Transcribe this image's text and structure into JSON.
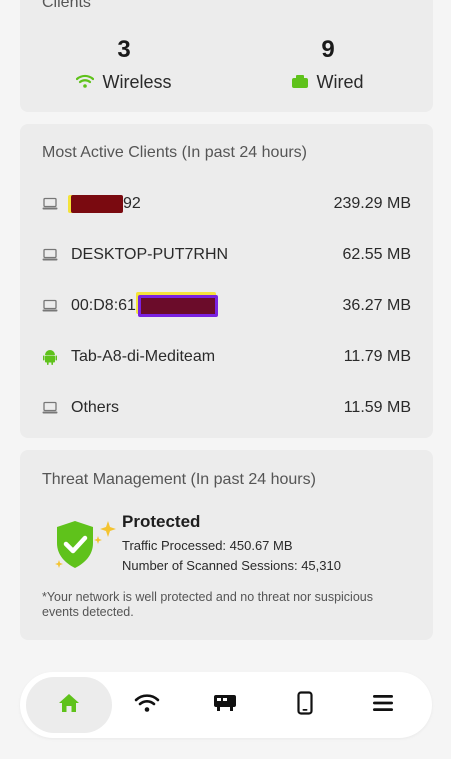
{
  "clients_card": {
    "clipped_title": "Clients",
    "wireless": {
      "count": "3",
      "label": "Wireless"
    },
    "wired": {
      "count": "9",
      "label": "Wired"
    }
  },
  "active_clients": {
    "title": "Most Active Clients (In past 24 hours)",
    "rows": [
      {
        "name_visible": "92",
        "value": "239.29 MB",
        "icon": "laptop-icon",
        "redacted": true
      },
      {
        "name_visible": "DESKTOP-PUT7RHN",
        "value": "62.55 MB",
        "icon": "laptop-icon",
        "redacted": false
      },
      {
        "name_visible": "00:D8:61",
        "value": "36.27 MB",
        "icon": "laptop-icon",
        "redacted": true
      },
      {
        "name_visible": "Tab-A8-di-Mediteam",
        "value": "11.79 MB",
        "icon": "android-icon",
        "redacted": false
      },
      {
        "name_visible": "Others",
        "value": "11.59 MB",
        "icon": "laptop-icon",
        "redacted": false
      }
    ]
  },
  "threat": {
    "title": "Threat Management (In past 24 hours)",
    "status": "Protected",
    "traffic": "Traffic Processed: 450.67 MB",
    "sessions": "Number of Scanned Sessions: 45,310",
    "note": "*Your network is well protected and no threat nor suspicious events detected."
  },
  "nav": {
    "items": [
      "home-icon",
      "wifi-icon",
      "devices-icon",
      "mobile-icon",
      "menu-icon"
    ],
    "active": "home-icon"
  },
  "colors": {
    "accent": "#5fc21b",
    "text_dark": "#222222",
    "muted": "#555555",
    "card_bg": "#ececec",
    "page_bg": "#f5f5f5"
  }
}
